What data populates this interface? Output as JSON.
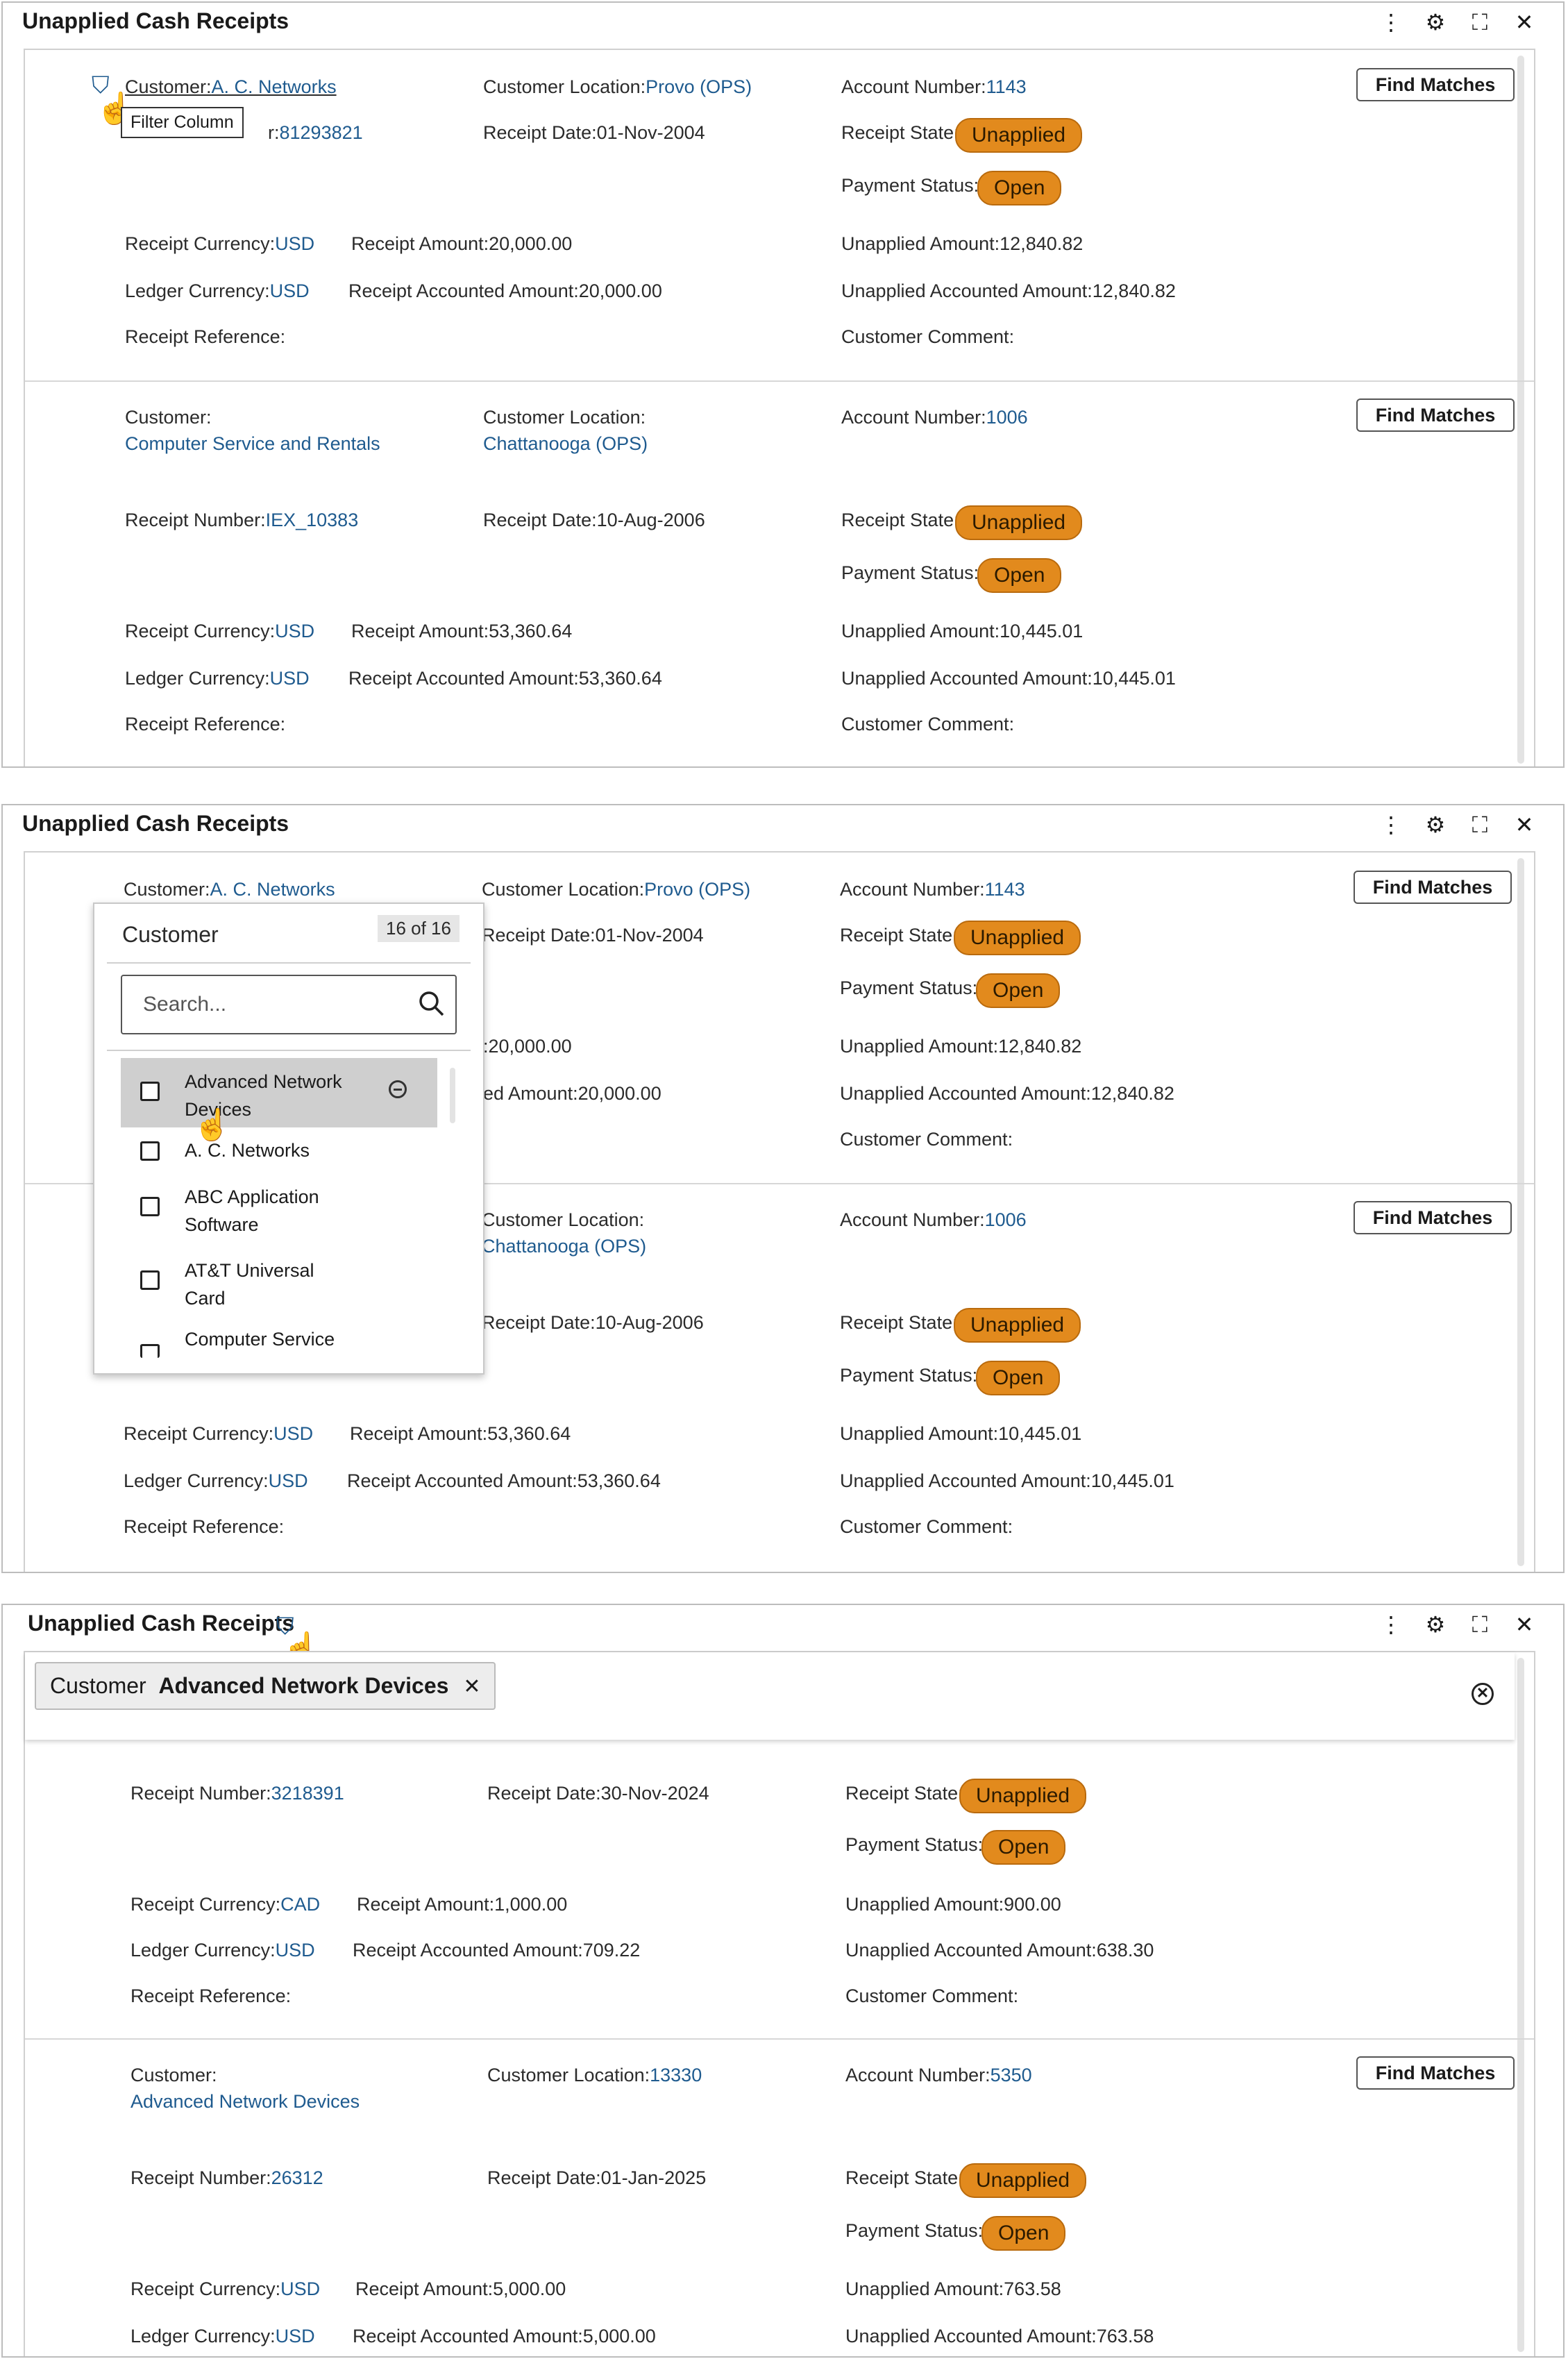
{
  "panel_title": "Unapplied Cash Receipts",
  "icons": {
    "more": "⋮",
    "settings": "⚙",
    "expand": "⛶",
    "close": "✕",
    "filter": "⛉",
    "cursor": "☝"
  },
  "labels": {
    "customer": "Customer:",
    "customer_location": "Customer Location:",
    "account_number": "Account Number:",
    "receipt_number": "Receipt Number:",
    "receipt_date": "Receipt Date:",
    "receipt_state": "Receipt State:",
    "payment_status": "Payment Status:",
    "receipt_currency": "Receipt Currency:",
    "receipt_amount": "Receipt Amount:",
    "unapplied_amount": "Unapplied Amount:",
    "ledger_currency": "Ledger Currency:",
    "receipt_accounted_amount": "Receipt Accounted Amount:",
    "unapplied_accounted_amount": "Unapplied Accounted Amount:",
    "receipt_reference": "Receipt Reference:",
    "customer_comment": "Customer Comment:",
    "find_matches": "Find Matches",
    "receipt_number_partial": "r:"
  },
  "badges": {
    "unapplied": "Unapplied",
    "open": "Open"
  },
  "tooltip": "Filter Column",
  "receipts": [
    {
      "customer": "A. C. Networks",
      "customer_location": "Provo (OPS)",
      "account_number": "1143",
      "receipt_number": "81293821",
      "receipt_date": "01-Nov-2004",
      "receipt_currency": "USD",
      "receipt_amount": "20,000.00",
      "unapplied_amount": "12,840.82",
      "ledger_currency": "USD",
      "receipt_accounted_amount": "20,000.00",
      "unapplied_accounted_amount": "12,840.82"
    },
    {
      "customer": "Computer Service and Rentals",
      "customer_location": "Chattanooga (OPS)",
      "account_number": "1006",
      "receipt_number": "IEX_10383",
      "receipt_date": "10-Aug-2006",
      "receipt_currency": "USD",
      "receipt_amount": "53,360.64",
      "unapplied_amount": "10,445.01",
      "ledger_currency": "USD",
      "receipt_accounted_amount": "53,360.64",
      "unapplied_accounted_amount": "10,445.01"
    }
  ],
  "panel2_partial": {
    "receipt_amount_tail": ":20,000.00",
    "accounted_tail": "ed Amount:20,000.00"
  },
  "dropdown": {
    "title": "Customer",
    "count": "16 of 16",
    "search_placeholder": "Search...",
    "items": [
      {
        "line1": "Advanced Network",
        "line2": "Devices"
      },
      {
        "line1": "A. C. Networks",
        "line2": ""
      },
      {
        "line1": "ABC Application",
        "line2": "Software"
      },
      {
        "line1": "AT&T Universal",
        "line2": "Card"
      },
      {
        "line1": "Computer Service",
        "line2": ""
      }
    ]
  },
  "filter_chip": {
    "label": "Customer",
    "value": "Advanced Network Devices"
  },
  "filtered_receipts": [
    {
      "receipt_number": "3218391",
      "receipt_date": "30-Nov-2024",
      "receipt_currency": "CAD",
      "receipt_amount": "1,000.00",
      "unapplied_amount": "900.00",
      "ledger_currency": "USD",
      "receipt_accounted_amount": "709.22",
      "unapplied_accounted_amount": "638.30"
    },
    {
      "customer": "Advanced Network Devices",
      "customer_location": "13330",
      "account_number": "5350",
      "receipt_number": "26312",
      "receipt_date": "01-Jan-2025",
      "receipt_currency": "USD",
      "receipt_amount": "5,000.00",
      "unapplied_amount": "763.58",
      "ledger_currency": "USD",
      "receipt_accounted_amount": "5,000.00",
      "unapplied_accounted_amount": "763.58"
    }
  ]
}
